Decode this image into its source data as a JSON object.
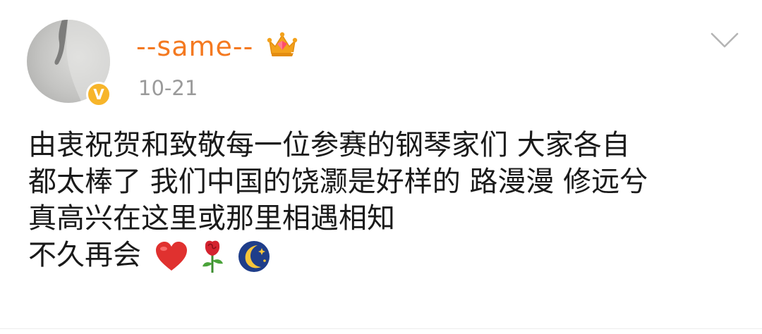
{
  "post": {
    "username": "--same--",
    "date": "10-21",
    "lines": [
      "由衷祝贺和致敬每一位参赛的钢琴家们 大家各自",
      "都太棒了 我们中国的饶灏是好样的 路漫漫 修远兮",
      "真高兴在这里或那里相遇相知",
      "不久再会"
    ],
    "verified_badge": "V"
  },
  "icons": {
    "badge": "crown-icon",
    "menu": "chevron-down-icon",
    "emoji": [
      "heart-emoji",
      "rose-emoji",
      "moon-emoji"
    ]
  },
  "colors": {
    "username": "#f47920",
    "date": "#9a9a9a",
    "text": "#1a1a1a",
    "verified": "#f7b52a"
  }
}
